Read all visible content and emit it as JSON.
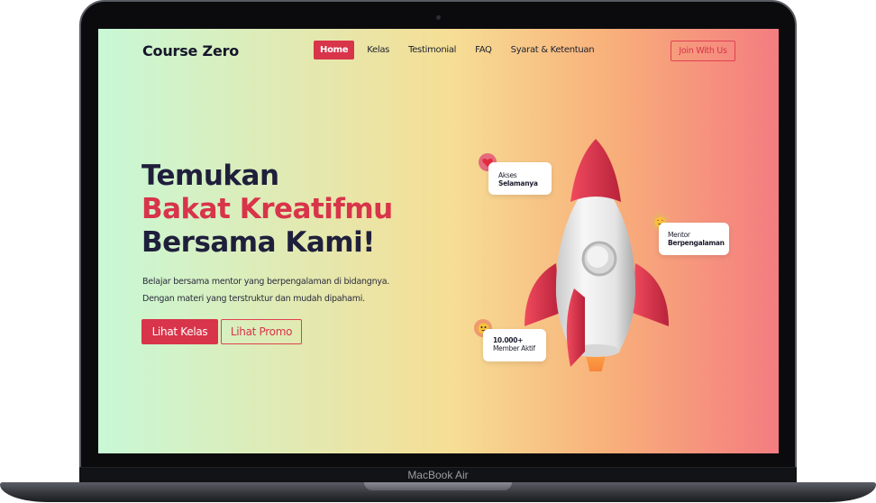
{
  "device": {
    "label": "MacBook Air"
  },
  "nav": {
    "logo": "Course Zero",
    "items": [
      {
        "label": "Home",
        "active": true
      },
      {
        "label": "Kelas",
        "active": false
      },
      {
        "label": "Testimonial",
        "active": false
      },
      {
        "label": "FAQ",
        "active": false
      },
      {
        "label": "Syarat & Ketentuan",
        "active": false
      }
    ],
    "cta": "Join With Us"
  },
  "hero": {
    "title_line1": "Temukan",
    "title_line2": "Bakat Kreatifmu",
    "title_line3": "Bersama Kami!",
    "desc_line1": "Belajar bersama mentor yang berpengalaman di bidangnya.",
    "desc_line2": "Dengan materi yang terstruktur dan mudah dipahami.",
    "primary_button": "Lihat Kelas",
    "secondary_button": "Lihat Promo"
  },
  "features": [
    {
      "label": "Akses",
      "value": "Selamanya",
      "icon": "heart-icon"
    },
    {
      "label": "Mentor",
      "value": "Berpengalaman",
      "icon": "star-eyes-emoji-icon"
    },
    {
      "label": "10.000+",
      "value": "Member Aktif",
      "icon": "party-emoji-icon"
    }
  ],
  "colors": {
    "accent": "#d8344a",
    "text_dark": "#1f1f3c",
    "gradient_left": "#c8f8d6",
    "gradient_mid": "#f6de95",
    "gradient_right": "#f47c80"
  }
}
